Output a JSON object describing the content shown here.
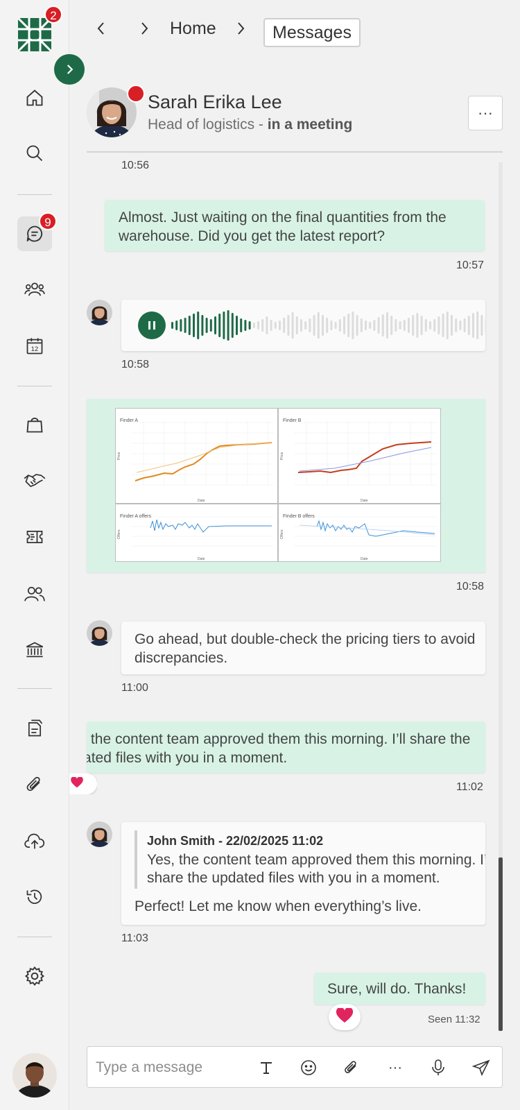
{
  "app": {
    "notification_count": "2",
    "colors": {
      "brand": "#1e6a47",
      "badge": "#d81f26",
      "outgoing_bubble": "#d8f3e6"
    }
  },
  "sidebar": {
    "items": [
      {
        "name": "home",
        "icon": "home-icon"
      },
      {
        "name": "search",
        "icon": "search-icon"
      },
      {
        "name": "messages",
        "icon": "chat-icon",
        "badge": "9",
        "active": true
      },
      {
        "name": "groups",
        "icon": "people-icon"
      },
      {
        "name": "calendar",
        "icon": "calendar-icon",
        "day": "12"
      },
      {
        "name": "shopping",
        "icon": "bag-icon"
      },
      {
        "name": "deals",
        "icon": "handshake-icon"
      },
      {
        "name": "tickets",
        "icon": "ticket-icon"
      },
      {
        "name": "contacts",
        "icon": "contacts-icon"
      },
      {
        "name": "bank",
        "icon": "bank-icon"
      },
      {
        "name": "documents",
        "icon": "documents-icon"
      },
      {
        "name": "attachments",
        "icon": "paperclip-icon"
      },
      {
        "name": "upload",
        "icon": "cloud-upload-icon"
      },
      {
        "name": "history",
        "icon": "history-icon"
      },
      {
        "name": "settings",
        "icon": "gear-icon"
      }
    ]
  },
  "topnav": {
    "breadcrumb_home": "Home",
    "breadcrumb_current": "Messages"
  },
  "contact": {
    "name": "Sarah Erika Lee",
    "role": "Head of logistics - ",
    "status": "in a meeting"
  },
  "messages": [
    {
      "time": "10:56"
    },
    {
      "direction": "out",
      "text": "Almost. Just waiting on the final quantities from the warehouse. Did you get the latest report?",
      "time": "10:57"
    },
    {
      "direction": "in",
      "type": "voice",
      "time": "10:58"
    },
    {
      "direction": "out",
      "type": "image",
      "time": "10:58"
    },
    {
      "direction": "in",
      "text": "Go ahead, but double-check the pricing tiers to avoid discrepancies.",
      "time": "11:00"
    },
    {
      "direction": "out",
      "text": "Yes, the content team approved them this morning. I’ll share the updated files with you in a moment.",
      "time": "11:02"
    },
    {
      "direction": "in",
      "quote_author": "John Smith - 22/02/2025 11:02",
      "quote_text": "Yes, the content team approved them this morning. I’ll share the updated files with you in a moment.",
      "text": "Perfect! Let me know when everything’s live.",
      "time": "11:03"
    },
    {
      "direction": "out",
      "text": "Sure, will do. Thanks!",
      "time": "Seen 11:32",
      "reaction": "heart-icon"
    }
  ],
  "image_attachment": {
    "panels": [
      "Finder A",
      "Finder B",
      "Finder A offers",
      "Finder B offers"
    ],
    "y_labels": [
      "Price",
      "Price",
      "Offers",
      "Offers"
    ],
    "x_label": "Date",
    "finder_a_y_ticks": [
      "45000",
      "40000",
      "35000",
      "30000",
      "25000",
      "20000",
      "15000",
      "10000",
      "5000",
      "0"
    ],
    "finder_b_y_ticks": [
      "18000",
      "16000",
      "14000",
      "12000",
      "10000",
      "8000",
      "6000",
      "4000",
      "2000",
      "0"
    ],
    "offers_y_ticks": [
      "60",
      "40",
      "20",
      "0"
    ],
    "date_ticks": [
      "01-Jul-2020",
      "01-Jan-2021",
      "01-Jul-2021",
      "01-Jan-2022",
      "01-Jul-2022",
      "01-Jan-2023",
      "01-Jul-2023"
    ]
  },
  "composer": {
    "placeholder": "Type a message"
  }
}
